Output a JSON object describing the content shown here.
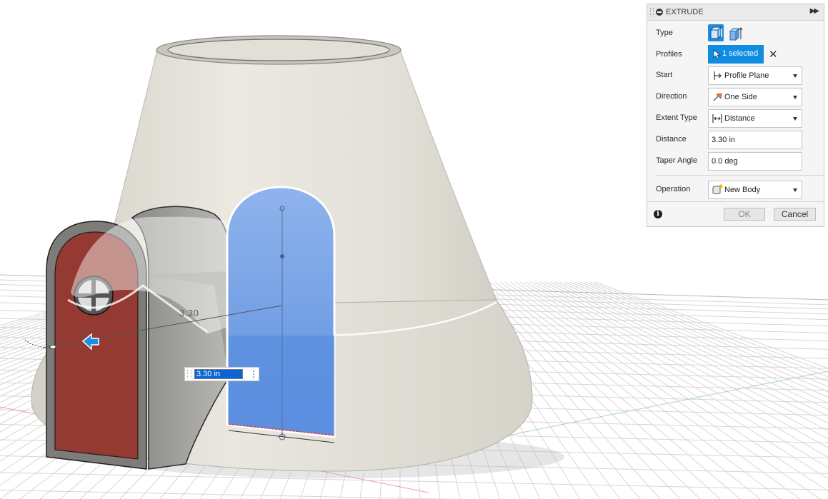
{
  "viewport": {
    "dimension_label": "3.30",
    "distance_input_value": "3.30 in"
  },
  "panel": {
    "title": "EXTRUDE",
    "rows": {
      "type": {
        "label": "Type"
      },
      "profiles": {
        "label": "Profiles",
        "value": "1 selected"
      },
      "start": {
        "label": "Start",
        "value": "Profile Plane"
      },
      "direction": {
        "label": "Direction",
        "value": "One Side"
      },
      "extent_type": {
        "label": "Extent Type",
        "value": "Distance"
      },
      "distance": {
        "label": "Distance",
        "value": "3.30 in"
      },
      "taper_angle": {
        "label": "Taper Angle",
        "value": "0.0 deg"
      },
      "operation": {
        "label": "Operation",
        "value": "New Body"
      }
    },
    "ok_label": "OK",
    "cancel_label": "Cancel"
  },
  "colors": {
    "accent": "#0f8de2",
    "body": "#e4e1da",
    "door": "#943a32",
    "profile_blue": "#6a9ae3"
  }
}
